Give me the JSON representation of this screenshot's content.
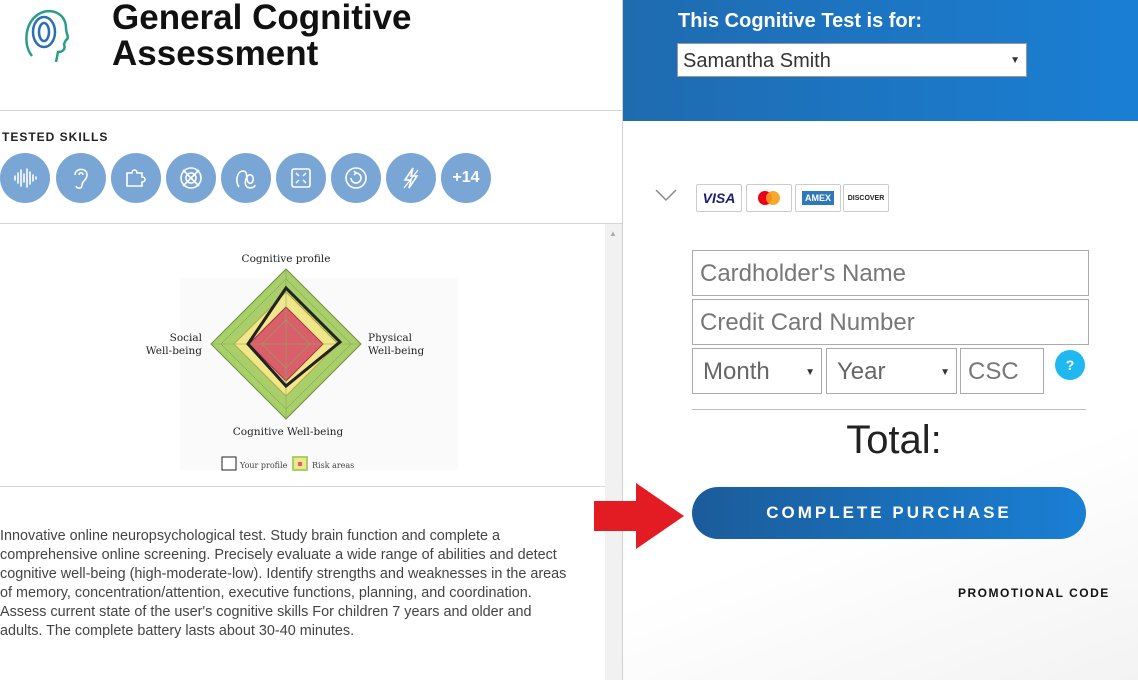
{
  "header": {
    "title_line1": "General Cognitive",
    "title_line2": "Assessment"
  },
  "skills": {
    "label": "TESTED SKILLS",
    "icons": [
      "sound-wave-icon",
      "ear-icon",
      "puzzle-icon",
      "target-icon",
      "brain-loop-icon",
      "focus-frame-icon",
      "cycle-icon",
      "lightning-icon"
    ],
    "more": "+14"
  },
  "chart_data": {
    "type": "radar",
    "title": "Cognitive profile",
    "axes": [
      "Cognitive profile",
      "Physical Well-being",
      "Cognitive Well-being",
      "Social Well-being"
    ],
    "axis_labels": {
      "top": "Cognitive profile",
      "right_l1": "Physical",
      "right_l2": "Well-being",
      "bottom": "Cognitive Well-being",
      "left_l1": "Social",
      "left_l2": "Well-being"
    },
    "legend": [
      {
        "name": "Your profile"
      },
      {
        "name": "Risk areas"
      }
    ],
    "legend_labels": {
      "profile": "Your profile",
      "risk": "Risk areas"
    },
    "colors": {
      "outer": "#a9cf6a",
      "middle": "#f0e68a",
      "inner": "#d9606a",
      "profile": "#222222"
    }
  },
  "description": "Innovative online neuropsychological test. Study brain function and complete a comprehensive online screening. Precisely evaluate a wide range of abilities and detect cognitive well-being (high-moderate-low). Identify strengths and weaknesses in the areas of memory, concentration/attention, executive functions, planning, and coordination. Assess current state of the user's cognitive skills For children 7 years and older and adults. The complete battery lasts about 30-40 minutes.",
  "purchase": {
    "for_label": "This Cognitive Test is for:",
    "selected_user": "Samantha Smith",
    "cards": [
      "VISA",
      "Mastercard",
      "AMEX",
      "DISCOVER"
    ],
    "cardholder_placeholder": "Cardholder's Name",
    "card_number_placeholder": "Credit Card Number",
    "month_placeholder": "Month",
    "year_placeholder": "Year",
    "csc_placeholder": "CSC",
    "help": "?",
    "total_label": "Total:",
    "button": "COMPLETE PURCHASE",
    "promo": "PROMOTIONAL CODE"
  },
  "colors": {
    "brand_blue": "#1a7fd4",
    "skill_blue": "#7aa6d6",
    "arrow_red": "#e31b23",
    "help_cyan": "#1fb8f0"
  }
}
